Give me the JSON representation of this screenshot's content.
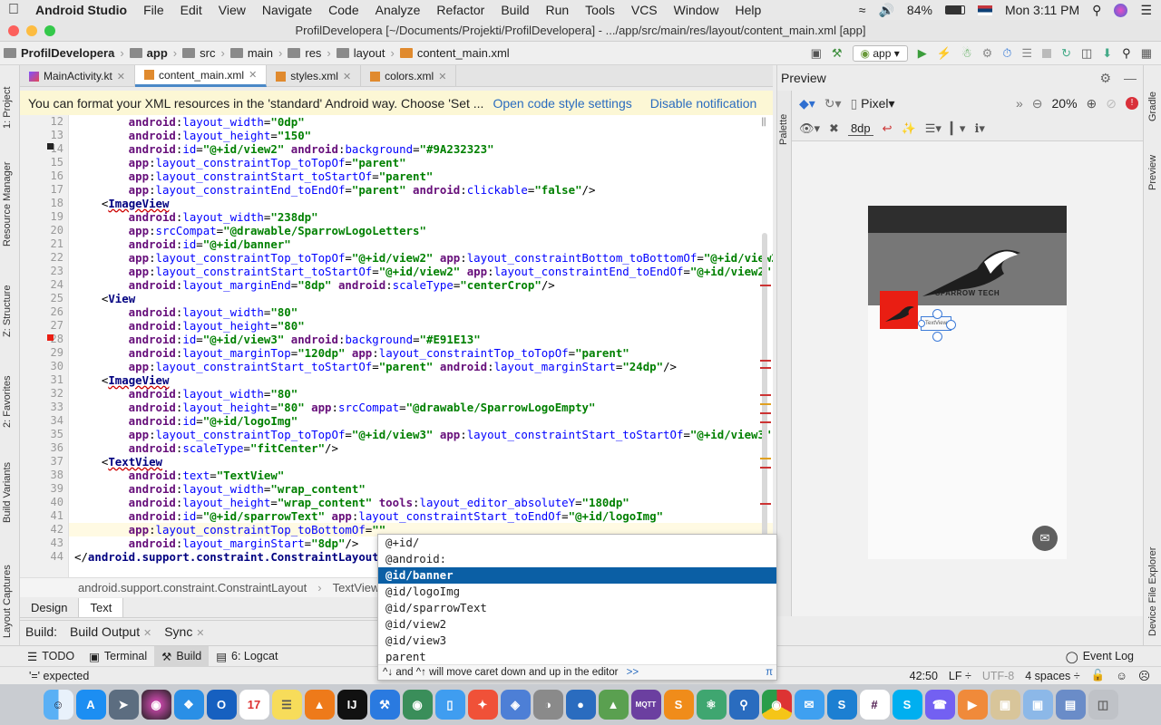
{
  "menubar": {
    "app_name": "Android Studio",
    "items": [
      "File",
      "Edit",
      "View",
      "Navigate",
      "Code",
      "Analyze",
      "Refactor",
      "Build",
      "Run",
      "Tools",
      "VCS",
      "Window",
      "Help"
    ],
    "battery": "84%",
    "clock": "Mon 3:11 PM"
  },
  "window": {
    "title": "ProfilDevelopera [~/Documents/Projekti/ProfilDevelopera] - .../app/src/main/res/layout/content_main.xml [app]"
  },
  "navbar": {
    "crumbs": [
      "ProfilDevelopera",
      "app",
      "src",
      "main",
      "res",
      "layout",
      "content_main.xml"
    ],
    "run_config": "app"
  },
  "left_tools": {
    "project": "1: Project",
    "resource_manager": "Resource Manager",
    "structure": "Z: Structure",
    "favorites": "2: Favorites",
    "build_variants": "Build Variants",
    "layout_captures": "Layout Captures"
  },
  "tabs": [
    {
      "label": "MainActivity.kt",
      "active": false
    },
    {
      "label": "content_main.xml",
      "active": true
    },
    {
      "label": "styles.xml",
      "active": false
    },
    {
      "label": "colors.xml",
      "active": false
    }
  ],
  "notification": {
    "text": "You can format your XML resources in the 'standard' Android way. Choose 'Set ...",
    "link1": "Open code style settings",
    "link2": "Disable notification"
  },
  "editor": {
    "line_numbers": [
      "12",
      "13",
      "14",
      "15",
      "16",
      "17",
      "18",
      "19",
      "20",
      "21",
      "22",
      "23",
      "24",
      "25",
      "26",
      "27",
      "28",
      "29",
      "30",
      "31",
      "32",
      "33",
      "34",
      "35",
      "36",
      "37",
      "38",
      "39",
      "40",
      "41",
      "42",
      "43",
      "44"
    ],
    "lines": [
      [
        {
          "c": "ns",
          "t": "        android"
        },
        {
          "c": "pn",
          "t": ":"
        },
        {
          "c": "at",
          "t": "layout_width"
        },
        {
          "c": "pn",
          "t": "="
        },
        {
          "c": "val",
          "t": "\"0dp\""
        }
      ],
      [
        {
          "c": "ns",
          "t": "        android"
        },
        {
          "c": "pn",
          "t": ":"
        },
        {
          "c": "at",
          "t": "layout_height"
        },
        {
          "c": "pn",
          "t": "="
        },
        {
          "c": "val",
          "t": "\"150\""
        }
      ],
      [
        {
          "c": "ns",
          "t": "        android"
        },
        {
          "c": "pn",
          "t": ":"
        },
        {
          "c": "at",
          "t": "id"
        },
        {
          "c": "pn",
          "t": "="
        },
        {
          "c": "val",
          "t": "\"@+id/view2\""
        },
        {
          "c": "ns",
          "t": " android"
        },
        {
          "c": "pn",
          "t": ":"
        },
        {
          "c": "at",
          "t": "background"
        },
        {
          "c": "pn",
          "t": "="
        },
        {
          "c": "val",
          "t": "\"#9A232323\""
        }
      ],
      [
        {
          "c": "ns",
          "t": "        app"
        },
        {
          "c": "pn",
          "t": ":"
        },
        {
          "c": "at",
          "t": "layout_constraintTop_toTopOf"
        },
        {
          "c": "pn",
          "t": "="
        },
        {
          "c": "val",
          "t": "\"parent\""
        }
      ],
      [
        {
          "c": "ns",
          "t": "        app"
        },
        {
          "c": "pn",
          "t": ":"
        },
        {
          "c": "at",
          "t": "layout_constraintStart_toStartOf"
        },
        {
          "c": "pn",
          "t": "="
        },
        {
          "c": "val",
          "t": "\"parent\""
        }
      ],
      [
        {
          "c": "ns",
          "t": "        app"
        },
        {
          "c": "pn",
          "t": ":"
        },
        {
          "c": "at",
          "t": "layout_constraintEnd_toEndOf"
        },
        {
          "c": "pn",
          "t": "="
        },
        {
          "c": "val",
          "t": "\"parent\""
        },
        {
          "c": "ns",
          "t": " android"
        },
        {
          "c": "pn",
          "t": ":"
        },
        {
          "c": "at",
          "t": "clickable"
        },
        {
          "c": "pn",
          "t": "="
        },
        {
          "c": "val",
          "t": "\"false\""
        },
        {
          "c": "pn",
          "t": "/>"
        }
      ],
      [
        {
          "c": "pn",
          "t": "    <"
        },
        {
          "c": "tag u",
          "t": "ImageView"
        }
      ],
      [
        {
          "c": "ns",
          "t": "        android"
        },
        {
          "c": "pn",
          "t": ":"
        },
        {
          "c": "at",
          "t": "layout_width"
        },
        {
          "c": "pn",
          "t": "="
        },
        {
          "c": "val",
          "t": "\"238dp\""
        }
      ],
      [
        {
          "c": "ns",
          "t": "        app"
        },
        {
          "c": "pn",
          "t": ":"
        },
        {
          "c": "at",
          "t": "srcCompat"
        },
        {
          "c": "pn",
          "t": "="
        },
        {
          "c": "val",
          "t": "\"@drawable/SparrowLogoLetters\""
        }
      ],
      [
        {
          "c": "ns",
          "t": "        android"
        },
        {
          "c": "pn",
          "t": ":"
        },
        {
          "c": "at",
          "t": "id"
        },
        {
          "c": "pn",
          "t": "="
        },
        {
          "c": "val",
          "t": "\"@+id/banner\""
        }
      ],
      [
        {
          "c": "ns",
          "t": "        app"
        },
        {
          "c": "pn",
          "t": ":"
        },
        {
          "c": "at",
          "t": "layout_constraintTop_toTopOf"
        },
        {
          "c": "pn",
          "t": "="
        },
        {
          "c": "val",
          "t": "\"@+id/view2\""
        },
        {
          "c": "ns",
          "t": " app"
        },
        {
          "c": "pn",
          "t": ":"
        },
        {
          "c": "at",
          "t": "layout_constraintBottom_toBottomOf"
        },
        {
          "c": "pn",
          "t": "="
        },
        {
          "c": "val",
          "t": "\"@+id/view2\""
        }
      ],
      [
        {
          "c": "ns",
          "t": "        app"
        },
        {
          "c": "pn",
          "t": ":"
        },
        {
          "c": "at",
          "t": "layout_constraintStart_toStartOf"
        },
        {
          "c": "pn",
          "t": "="
        },
        {
          "c": "val",
          "t": "\"@+id/view2\""
        },
        {
          "c": "ns",
          "t": " app"
        },
        {
          "c": "pn",
          "t": ":"
        },
        {
          "c": "at",
          "t": "layout_constraintEnd_toEndOf"
        },
        {
          "c": "pn",
          "t": "="
        },
        {
          "c": "val",
          "t": "\"@+id/view2\""
        }
      ],
      [
        {
          "c": "ns",
          "t": "        android"
        },
        {
          "c": "pn",
          "t": ":"
        },
        {
          "c": "at",
          "t": "layout_marginEnd"
        },
        {
          "c": "pn",
          "t": "="
        },
        {
          "c": "val",
          "t": "\"8dp\""
        },
        {
          "c": "ns",
          "t": " android"
        },
        {
          "c": "pn",
          "t": ":"
        },
        {
          "c": "at",
          "t": "scaleType"
        },
        {
          "c": "pn",
          "t": "="
        },
        {
          "c": "val",
          "t": "\"centerCrop\""
        },
        {
          "c": "pn",
          "t": "/>"
        }
      ],
      [
        {
          "c": "pn",
          "t": "    <"
        },
        {
          "c": "tag",
          "t": "View"
        }
      ],
      [
        {
          "c": "ns",
          "t": "        android"
        },
        {
          "c": "pn",
          "t": ":"
        },
        {
          "c": "at",
          "t": "layout_width"
        },
        {
          "c": "pn",
          "t": "="
        },
        {
          "c": "val",
          "t": "\"80\""
        }
      ],
      [
        {
          "c": "ns",
          "t": "        android"
        },
        {
          "c": "pn",
          "t": ":"
        },
        {
          "c": "at",
          "t": "layout_height"
        },
        {
          "c": "pn",
          "t": "="
        },
        {
          "c": "val",
          "t": "\"80\""
        }
      ],
      [
        {
          "c": "ns",
          "t": "        android"
        },
        {
          "c": "pn",
          "t": ":"
        },
        {
          "c": "at",
          "t": "id"
        },
        {
          "c": "pn",
          "t": "="
        },
        {
          "c": "val",
          "t": "\"@+id/view3\""
        },
        {
          "c": "ns",
          "t": " android"
        },
        {
          "c": "pn",
          "t": ":"
        },
        {
          "c": "at",
          "t": "background"
        },
        {
          "c": "pn",
          "t": "="
        },
        {
          "c": "val",
          "t": "\"#E91E13\""
        }
      ],
      [
        {
          "c": "ns",
          "t": "        android"
        },
        {
          "c": "pn",
          "t": ":"
        },
        {
          "c": "at",
          "t": "layout_marginTop"
        },
        {
          "c": "pn",
          "t": "="
        },
        {
          "c": "val",
          "t": "\"120dp\""
        },
        {
          "c": "ns",
          "t": " app"
        },
        {
          "c": "pn",
          "t": ":"
        },
        {
          "c": "at",
          "t": "layout_constraintTop_toTopOf"
        },
        {
          "c": "pn",
          "t": "="
        },
        {
          "c": "val",
          "t": "\"parent\""
        }
      ],
      [
        {
          "c": "ns",
          "t": "        app"
        },
        {
          "c": "pn",
          "t": ":"
        },
        {
          "c": "at",
          "t": "layout_constraintStart_toStartOf"
        },
        {
          "c": "pn",
          "t": "="
        },
        {
          "c": "val",
          "t": "\"parent\""
        },
        {
          "c": "ns",
          "t": " android"
        },
        {
          "c": "pn",
          "t": ":"
        },
        {
          "c": "at",
          "t": "layout_marginStart"
        },
        {
          "c": "pn",
          "t": "="
        },
        {
          "c": "val",
          "t": "\"24dp\""
        },
        {
          "c": "pn",
          "t": "/>"
        }
      ],
      [
        {
          "c": "pn",
          "t": "    <"
        },
        {
          "c": "tag u",
          "t": "ImageView"
        }
      ],
      [
        {
          "c": "ns",
          "t": "        android"
        },
        {
          "c": "pn",
          "t": ":"
        },
        {
          "c": "at",
          "t": "layout_width"
        },
        {
          "c": "pn",
          "t": "="
        },
        {
          "c": "val",
          "t": "\"80\""
        }
      ],
      [
        {
          "c": "ns",
          "t": "        android"
        },
        {
          "c": "pn",
          "t": ":"
        },
        {
          "c": "at",
          "t": "layout_height"
        },
        {
          "c": "pn",
          "t": "="
        },
        {
          "c": "val",
          "t": "\"80\""
        },
        {
          "c": "ns",
          "t": " app"
        },
        {
          "c": "pn",
          "t": ":"
        },
        {
          "c": "at",
          "t": "srcCompat"
        },
        {
          "c": "pn",
          "t": "="
        },
        {
          "c": "val",
          "t": "\"@drawable/SparrowLogoEmpty\""
        }
      ],
      [
        {
          "c": "ns",
          "t": "        android"
        },
        {
          "c": "pn",
          "t": ":"
        },
        {
          "c": "at",
          "t": "id"
        },
        {
          "c": "pn",
          "t": "="
        },
        {
          "c": "val",
          "t": "\"@+id/logoImg\""
        }
      ],
      [
        {
          "c": "ns",
          "t": "        app"
        },
        {
          "c": "pn",
          "t": ":"
        },
        {
          "c": "at",
          "t": "layout_constraintTop_toTopOf"
        },
        {
          "c": "pn",
          "t": "="
        },
        {
          "c": "val",
          "t": "\"@+id/view3\""
        },
        {
          "c": "ns",
          "t": " app"
        },
        {
          "c": "pn",
          "t": ":"
        },
        {
          "c": "at",
          "t": "layout_constraintStart_toStartOf"
        },
        {
          "c": "pn",
          "t": "="
        },
        {
          "c": "val",
          "t": "\"@+id/view3\""
        }
      ],
      [
        {
          "c": "ns",
          "t": "        android"
        },
        {
          "c": "pn",
          "t": ":"
        },
        {
          "c": "at",
          "t": "scaleType"
        },
        {
          "c": "pn",
          "t": "="
        },
        {
          "c": "val",
          "t": "\"fitCenter\""
        },
        {
          "c": "pn",
          "t": "/>"
        }
      ],
      [
        {
          "c": "pn",
          "t": "    <"
        },
        {
          "c": "tag u",
          "t": "TextView"
        }
      ],
      [
        {
          "c": "ns",
          "t": "        android"
        },
        {
          "c": "pn",
          "t": ":"
        },
        {
          "c": "at",
          "t": "text"
        },
        {
          "c": "pn",
          "t": "="
        },
        {
          "c": "val",
          "t": "\"TextView\""
        }
      ],
      [
        {
          "c": "ns",
          "t": "        android"
        },
        {
          "c": "pn",
          "t": ":"
        },
        {
          "c": "at",
          "t": "layout_width"
        },
        {
          "c": "pn",
          "t": "="
        },
        {
          "c": "val",
          "t": "\"wrap_content\""
        }
      ],
      [
        {
          "c": "ns",
          "t": "        android"
        },
        {
          "c": "pn",
          "t": ":"
        },
        {
          "c": "at",
          "t": "layout_height"
        },
        {
          "c": "pn",
          "t": "="
        },
        {
          "c": "val",
          "t": "\"wrap_content\""
        },
        {
          "c": "ns",
          "t": " tools"
        },
        {
          "c": "pn",
          "t": ":"
        },
        {
          "c": "at",
          "t": "layout_editor_absoluteY"
        },
        {
          "c": "pn",
          "t": "="
        },
        {
          "c": "val",
          "t": "\"180dp\""
        }
      ],
      [
        {
          "c": "ns",
          "t": "        android"
        },
        {
          "c": "pn",
          "t": ":"
        },
        {
          "c": "at",
          "t": "id"
        },
        {
          "c": "pn",
          "t": "="
        },
        {
          "c": "val",
          "t": "\"@+id/sparrowText\""
        },
        {
          "c": "ns",
          "t": " app"
        },
        {
          "c": "pn",
          "t": ":"
        },
        {
          "c": "at",
          "t": "layout_constraintStart_toEndOf"
        },
        {
          "c": "pn",
          "t": "="
        },
        {
          "c": "val",
          "t": "\"@+id/logoImg\""
        }
      ],
      [
        {
          "c": "ns",
          "t": "        app"
        },
        {
          "c": "pn",
          "t": ":"
        },
        {
          "c": "at",
          "t": "layout_constraintTop_toBottomOf"
        },
        {
          "c": "pn",
          "t": "="
        },
        {
          "c": "val",
          "t": "\"\""
        }
      ],
      [
        {
          "c": "ns",
          "t": "        android"
        },
        {
          "c": "pn",
          "t": ":"
        },
        {
          "c": "at",
          "t": "layout_marginStart"
        },
        {
          "c": "pn",
          "t": "="
        },
        {
          "c": "val",
          "t": "\"8dp\""
        },
        {
          "c": "pn",
          "t": "/>"
        }
      ],
      [
        {
          "c": "pn",
          "t": "</"
        },
        {
          "c": "tag",
          "t": "android.support.constraint.ConstraintLayout"
        },
        {
          "c": "pn",
          "t": ">"
        }
      ]
    ]
  },
  "editor_breadcrumb": [
    "android.support.constraint.ConstraintLayout",
    "TextView"
  ],
  "design_tabs": {
    "design": "Design",
    "text": "Text"
  },
  "build": {
    "label": "Build:",
    "output": "Build Output",
    "sync": "Sync"
  },
  "autocomplete": {
    "items": [
      "@+id/",
      "@android:",
      "@id/banner",
      "@id/logoImg",
      "@id/sparrowText",
      "@id/view2",
      "@id/view3",
      "parent"
    ],
    "selected": "@id/banner",
    "hint": "^↓ and ^↑ will move caret down and up in the editor",
    "hint_link": ">>",
    "pi": "π"
  },
  "bottom_tools": {
    "todo": "TODO",
    "terminal": "Terminal",
    "build": "Build",
    "logcat": "6: Logcat",
    "event_log": "Event Log"
  },
  "statusbar": {
    "message": "'=' expected",
    "position": "42:50",
    "line_sep": "LF ÷",
    "encoding": "UTF-8",
    "indent": "4 spaces ÷"
  },
  "preview": {
    "title": "Preview",
    "palette": "Palette",
    "device": "Pixel",
    "zoom": "20%",
    "margin": "8dp",
    "sparrow_label": "SPARROW TECH",
    "textview_label": "TextView"
  },
  "right_tools": {
    "gradle": "Gradle",
    "preview": "Preview",
    "device_file_explorer": "Device File Explorer"
  },
  "colors": {
    "accent": "#E91E13",
    "selection": "#0B5FA5",
    "banner": "#232323"
  }
}
